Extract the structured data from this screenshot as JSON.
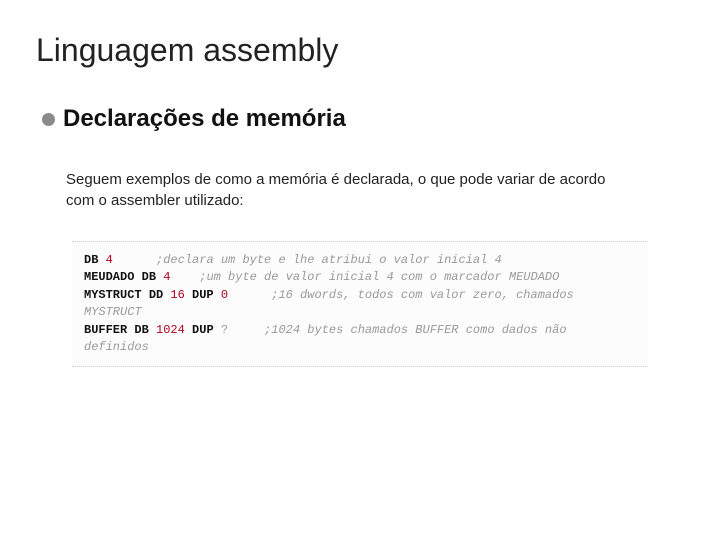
{
  "title": "Linguagem assembly",
  "subtitle": "Declarações de memória",
  "body": "Seguem exemplos de como a memória é declarada, o que pode variar de acordo com o assembler utilizado:",
  "code": {
    "line1": {
      "kw": "DB",
      "val": "4",
      "comment": ";declara um byte e lhe atribui o valor inicial 4"
    },
    "line2": {
      "label": "MEUDADO",
      "kw": "DB",
      "val": "4",
      "comment": ";um byte de valor inicial 4 com o marcador MEUDADO"
    },
    "line3": {
      "label": "MYSTRUCT",
      "kw": "DD",
      "count": "16",
      "dup": "DUP",
      "dupval": "0",
      "comment": ";16 dwords, todos com valor zero, chamados"
    },
    "line3b": {
      "text": "MYSTRUCT"
    },
    "line4": {
      "label": "BUFFER",
      "kw": "DB",
      "count": "1024",
      "dup": "DUP",
      "dupval": "?",
      "comment": ";1024 bytes chamados BUFFER como dados não"
    },
    "line4b": {
      "text": "definidos"
    }
  }
}
